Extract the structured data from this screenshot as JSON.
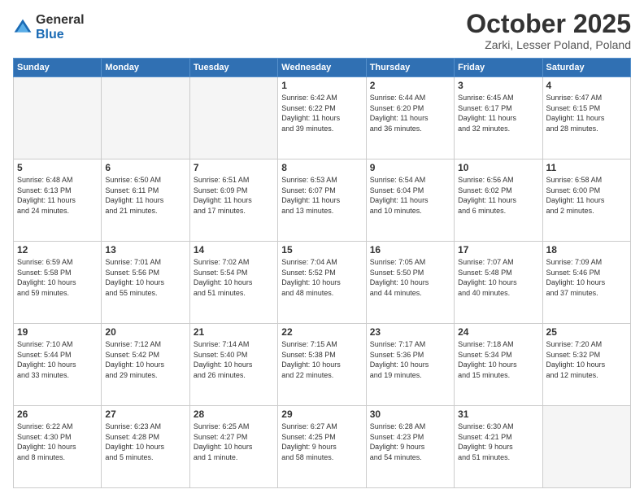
{
  "header": {
    "logo_general": "General",
    "logo_blue": "Blue",
    "month_title": "October 2025",
    "location": "Zarki, Lesser Poland, Poland"
  },
  "weekdays": [
    "Sunday",
    "Monday",
    "Tuesday",
    "Wednesday",
    "Thursday",
    "Friday",
    "Saturday"
  ],
  "weeks": [
    [
      {
        "day": "",
        "info": ""
      },
      {
        "day": "",
        "info": ""
      },
      {
        "day": "",
        "info": ""
      },
      {
        "day": "1",
        "info": "Sunrise: 6:42 AM\nSunset: 6:22 PM\nDaylight: 11 hours\nand 39 minutes."
      },
      {
        "day": "2",
        "info": "Sunrise: 6:44 AM\nSunset: 6:20 PM\nDaylight: 11 hours\nand 36 minutes."
      },
      {
        "day": "3",
        "info": "Sunrise: 6:45 AM\nSunset: 6:17 PM\nDaylight: 11 hours\nand 32 minutes."
      },
      {
        "day": "4",
        "info": "Sunrise: 6:47 AM\nSunset: 6:15 PM\nDaylight: 11 hours\nand 28 minutes."
      }
    ],
    [
      {
        "day": "5",
        "info": "Sunrise: 6:48 AM\nSunset: 6:13 PM\nDaylight: 11 hours\nand 24 minutes."
      },
      {
        "day": "6",
        "info": "Sunrise: 6:50 AM\nSunset: 6:11 PM\nDaylight: 11 hours\nand 21 minutes."
      },
      {
        "day": "7",
        "info": "Sunrise: 6:51 AM\nSunset: 6:09 PM\nDaylight: 11 hours\nand 17 minutes."
      },
      {
        "day": "8",
        "info": "Sunrise: 6:53 AM\nSunset: 6:07 PM\nDaylight: 11 hours\nand 13 minutes."
      },
      {
        "day": "9",
        "info": "Sunrise: 6:54 AM\nSunset: 6:04 PM\nDaylight: 11 hours\nand 10 minutes."
      },
      {
        "day": "10",
        "info": "Sunrise: 6:56 AM\nSunset: 6:02 PM\nDaylight: 11 hours\nand 6 minutes."
      },
      {
        "day": "11",
        "info": "Sunrise: 6:58 AM\nSunset: 6:00 PM\nDaylight: 11 hours\nand 2 minutes."
      }
    ],
    [
      {
        "day": "12",
        "info": "Sunrise: 6:59 AM\nSunset: 5:58 PM\nDaylight: 10 hours\nand 59 minutes."
      },
      {
        "day": "13",
        "info": "Sunrise: 7:01 AM\nSunset: 5:56 PM\nDaylight: 10 hours\nand 55 minutes."
      },
      {
        "day": "14",
        "info": "Sunrise: 7:02 AM\nSunset: 5:54 PM\nDaylight: 10 hours\nand 51 minutes."
      },
      {
        "day": "15",
        "info": "Sunrise: 7:04 AM\nSunset: 5:52 PM\nDaylight: 10 hours\nand 48 minutes."
      },
      {
        "day": "16",
        "info": "Sunrise: 7:05 AM\nSunset: 5:50 PM\nDaylight: 10 hours\nand 44 minutes."
      },
      {
        "day": "17",
        "info": "Sunrise: 7:07 AM\nSunset: 5:48 PM\nDaylight: 10 hours\nand 40 minutes."
      },
      {
        "day": "18",
        "info": "Sunrise: 7:09 AM\nSunset: 5:46 PM\nDaylight: 10 hours\nand 37 minutes."
      }
    ],
    [
      {
        "day": "19",
        "info": "Sunrise: 7:10 AM\nSunset: 5:44 PM\nDaylight: 10 hours\nand 33 minutes."
      },
      {
        "day": "20",
        "info": "Sunrise: 7:12 AM\nSunset: 5:42 PM\nDaylight: 10 hours\nand 29 minutes."
      },
      {
        "day": "21",
        "info": "Sunrise: 7:14 AM\nSunset: 5:40 PM\nDaylight: 10 hours\nand 26 minutes."
      },
      {
        "day": "22",
        "info": "Sunrise: 7:15 AM\nSunset: 5:38 PM\nDaylight: 10 hours\nand 22 minutes."
      },
      {
        "day": "23",
        "info": "Sunrise: 7:17 AM\nSunset: 5:36 PM\nDaylight: 10 hours\nand 19 minutes."
      },
      {
        "day": "24",
        "info": "Sunrise: 7:18 AM\nSunset: 5:34 PM\nDaylight: 10 hours\nand 15 minutes."
      },
      {
        "day": "25",
        "info": "Sunrise: 7:20 AM\nSunset: 5:32 PM\nDaylight: 10 hours\nand 12 minutes."
      }
    ],
    [
      {
        "day": "26",
        "info": "Sunrise: 6:22 AM\nSunset: 4:30 PM\nDaylight: 10 hours\nand 8 minutes."
      },
      {
        "day": "27",
        "info": "Sunrise: 6:23 AM\nSunset: 4:28 PM\nDaylight: 10 hours\nand 5 minutes."
      },
      {
        "day": "28",
        "info": "Sunrise: 6:25 AM\nSunset: 4:27 PM\nDaylight: 10 hours\nand 1 minute."
      },
      {
        "day": "29",
        "info": "Sunrise: 6:27 AM\nSunset: 4:25 PM\nDaylight: 9 hours\nand 58 minutes."
      },
      {
        "day": "30",
        "info": "Sunrise: 6:28 AM\nSunset: 4:23 PM\nDaylight: 9 hours\nand 54 minutes."
      },
      {
        "day": "31",
        "info": "Sunrise: 6:30 AM\nSunset: 4:21 PM\nDaylight: 9 hours\nand 51 minutes."
      },
      {
        "day": "",
        "info": ""
      }
    ]
  ]
}
